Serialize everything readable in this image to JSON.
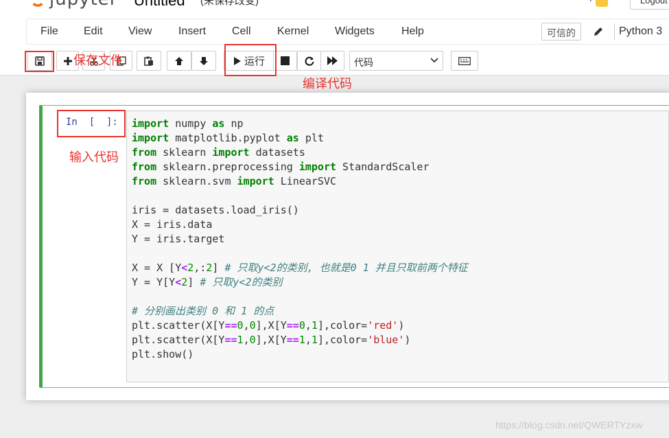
{
  "header": {
    "logo_text": "jupyter",
    "notebook_name": "Untitled",
    "save_status": "(未保存改变)",
    "logout_label": "Logout"
  },
  "menubar": {
    "items": [
      "File",
      "Edit",
      "View",
      "Insert",
      "Cell",
      "Kernel",
      "Widgets",
      "Help"
    ],
    "trusted_label": "可信的",
    "kernel_name": "Python 3"
  },
  "toolbar": {
    "run_label": "运行",
    "cell_type": "代码"
  },
  "annotations": {
    "save_file": "保存文件",
    "compile_code": "编译代码",
    "input_code": "输入代码"
  },
  "cell": {
    "prompt": "In  [  ]:",
    "code_lines": [
      [
        {
          "t": "import",
          "c": "kw"
        },
        {
          "t": " numpy "
        },
        {
          "t": "as",
          "c": "kw"
        },
        {
          "t": " np"
        }
      ],
      [
        {
          "t": "import",
          "c": "kw"
        },
        {
          "t": " matplotlib.pyplot "
        },
        {
          "t": "as",
          "c": "kw"
        },
        {
          "t": " plt"
        }
      ],
      [
        {
          "t": "from",
          "c": "kw"
        },
        {
          "t": " sklearn "
        },
        {
          "t": "import",
          "c": "kw"
        },
        {
          "t": " datasets"
        }
      ],
      [
        {
          "t": "from",
          "c": "kw"
        },
        {
          "t": " sklearn.preprocessing "
        },
        {
          "t": "import",
          "c": "kw"
        },
        {
          "t": " StandardScaler"
        }
      ],
      [
        {
          "t": "from",
          "c": "kw"
        },
        {
          "t": " sklearn.svm "
        },
        {
          "t": "import",
          "c": "kw"
        },
        {
          "t": " LinearSVC"
        }
      ],
      [
        {
          "t": ""
        }
      ],
      [
        {
          "t": "iris = datasets.load_iris()"
        }
      ],
      [
        {
          "t": "X = iris.data"
        }
      ],
      [
        {
          "t": "Y = iris.target"
        }
      ],
      [
        {
          "t": ""
        }
      ],
      [
        {
          "t": "X = X [Y"
        },
        {
          "t": "<",
          "c": "op"
        },
        {
          "t": "2",
          "c": "num"
        },
        {
          "t": ",:"
        },
        {
          "t": "2",
          "c": "num"
        },
        {
          "t": "] "
        },
        {
          "t": "# 只取y<2的类别, 也就是0 1 并且只取前两个特征",
          "c": "cm"
        }
      ],
      [
        {
          "t": "Y = Y[Y"
        },
        {
          "t": "<",
          "c": "op"
        },
        {
          "t": "2",
          "c": "num"
        },
        {
          "t": "] "
        },
        {
          "t": "# 只取y<2的类别",
          "c": "cm"
        }
      ],
      [
        {
          "t": ""
        }
      ],
      [
        {
          "t": "# 分别画出类别 0 和 1 的点",
          "c": "cm"
        }
      ],
      [
        {
          "t": "plt.scatter(X[Y"
        },
        {
          "t": "==",
          "c": "op"
        },
        {
          "t": "0",
          "c": "num"
        },
        {
          "t": ","
        },
        {
          "t": "0",
          "c": "num"
        },
        {
          "t": "],X[Y"
        },
        {
          "t": "==",
          "c": "op"
        },
        {
          "t": "0",
          "c": "num"
        },
        {
          "t": ","
        },
        {
          "t": "1",
          "c": "num"
        },
        {
          "t": "],color="
        },
        {
          "t": "'red'",
          "c": "str"
        },
        {
          "t": ")"
        }
      ],
      [
        {
          "t": "plt.scatter(X[Y"
        },
        {
          "t": "==",
          "c": "op"
        },
        {
          "t": "1",
          "c": "num"
        },
        {
          "t": ","
        },
        {
          "t": "0",
          "c": "num"
        },
        {
          "t": "],X[Y"
        },
        {
          "t": "==",
          "c": "op"
        },
        {
          "t": "1",
          "c": "num"
        },
        {
          "t": ","
        },
        {
          "t": "1",
          "c": "num"
        },
        {
          "t": "],color="
        },
        {
          "t": "'blue'",
          "c": "str"
        },
        {
          "t": ")"
        }
      ],
      [
        {
          "t": "plt.show()"
        }
      ]
    ]
  },
  "watermark": "https://blog.csdn.net/QWERTYzxw",
  "colors": {
    "annotation_red": "#e8322d",
    "cell_border_green": "#42a548",
    "prompt_blue": "#303f9f"
  }
}
